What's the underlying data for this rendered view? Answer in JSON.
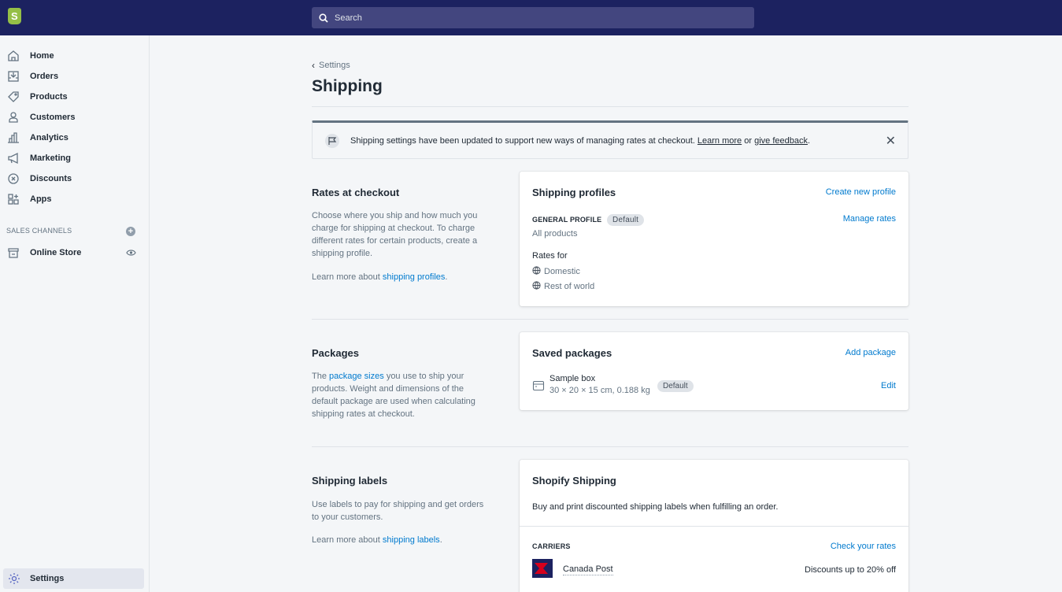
{
  "topbar": {
    "search_placeholder": "Search"
  },
  "sidebar": {
    "items": [
      {
        "label": "Home",
        "icon": "home-icon"
      },
      {
        "label": "Orders",
        "icon": "orders-icon"
      },
      {
        "label": "Products",
        "icon": "tag-icon"
      },
      {
        "label": "Customers",
        "icon": "person-icon"
      },
      {
        "label": "Analytics",
        "icon": "bar-chart-icon"
      },
      {
        "label": "Marketing",
        "icon": "megaphone-icon"
      },
      {
        "label": "Discounts",
        "icon": "discount-icon"
      },
      {
        "label": "Apps",
        "icon": "apps-icon"
      }
    ],
    "sales_channels_label": "SALES CHANNELS",
    "online_store": "Online Store",
    "settings": "Settings"
  },
  "page": {
    "breadcrumb": "Settings",
    "title": "Shipping"
  },
  "banner": {
    "text": "Shipping settings have been updated to support new ways of managing rates at checkout.",
    "learn_more": "Learn more",
    "or": "or",
    "give_feedback": "give feedback",
    "end": "."
  },
  "rates": {
    "title": "Rates at checkout",
    "desc": "Choose where you ship and how much you charge for shipping at checkout. To charge different rates for certain products, create a shipping profile.",
    "learn_prefix": "Learn more about",
    "learn_link": "shipping profiles",
    "learn_suffix": "."
  },
  "profiles_card": {
    "title": "Shipping profiles",
    "create_link": "Create new profile",
    "general_profile": "GENERAL PROFILE",
    "default_badge": "Default",
    "manage_rates": "Manage rates",
    "all_products": "All products",
    "rates_for": "Rates for",
    "zones": [
      "Domestic",
      "Rest of world"
    ]
  },
  "packages": {
    "title": "Packages",
    "desc_prefix": "The",
    "desc_link": "package sizes",
    "desc_suffix": "you use to ship your products. Weight and dimensions of the default package are used when calculating shipping rates at checkout."
  },
  "packages_card": {
    "title": "Saved packages",
    "add_link": "Add package",
    "package_name": "Sample box",
    "package_dims": "30 × 20 × 15 cm, 0.188 kg",
    "default_badge": "Default",
    "edit": "Edit"
  },
  "labels": {
    "title": "Shipping labels",
    "desc": "Use labels to pay for shipping and get orders to your customers.",
    "learn_prefix": "Learn more about",
    "learn_link": "shipping labels",
    "learn_suffix": "."
  },
  "shopify_shipping_card": {
    "title": "Shopify Shipping",
    "desc": "Buy and print discounted shipping labels when fulfilling an order.",
    "carriers_label": "CARRIERS",
    "check_rates": "Check your rates",
    "carrier_name": "Canada Post",
    "carrier_discount": "Discounts up to 20% off"
  },
  "colors": {
    "topbar": "#1c2260",
    "link": "#007ace",
    "canada_post_red": "#d6001c"
  }
}
